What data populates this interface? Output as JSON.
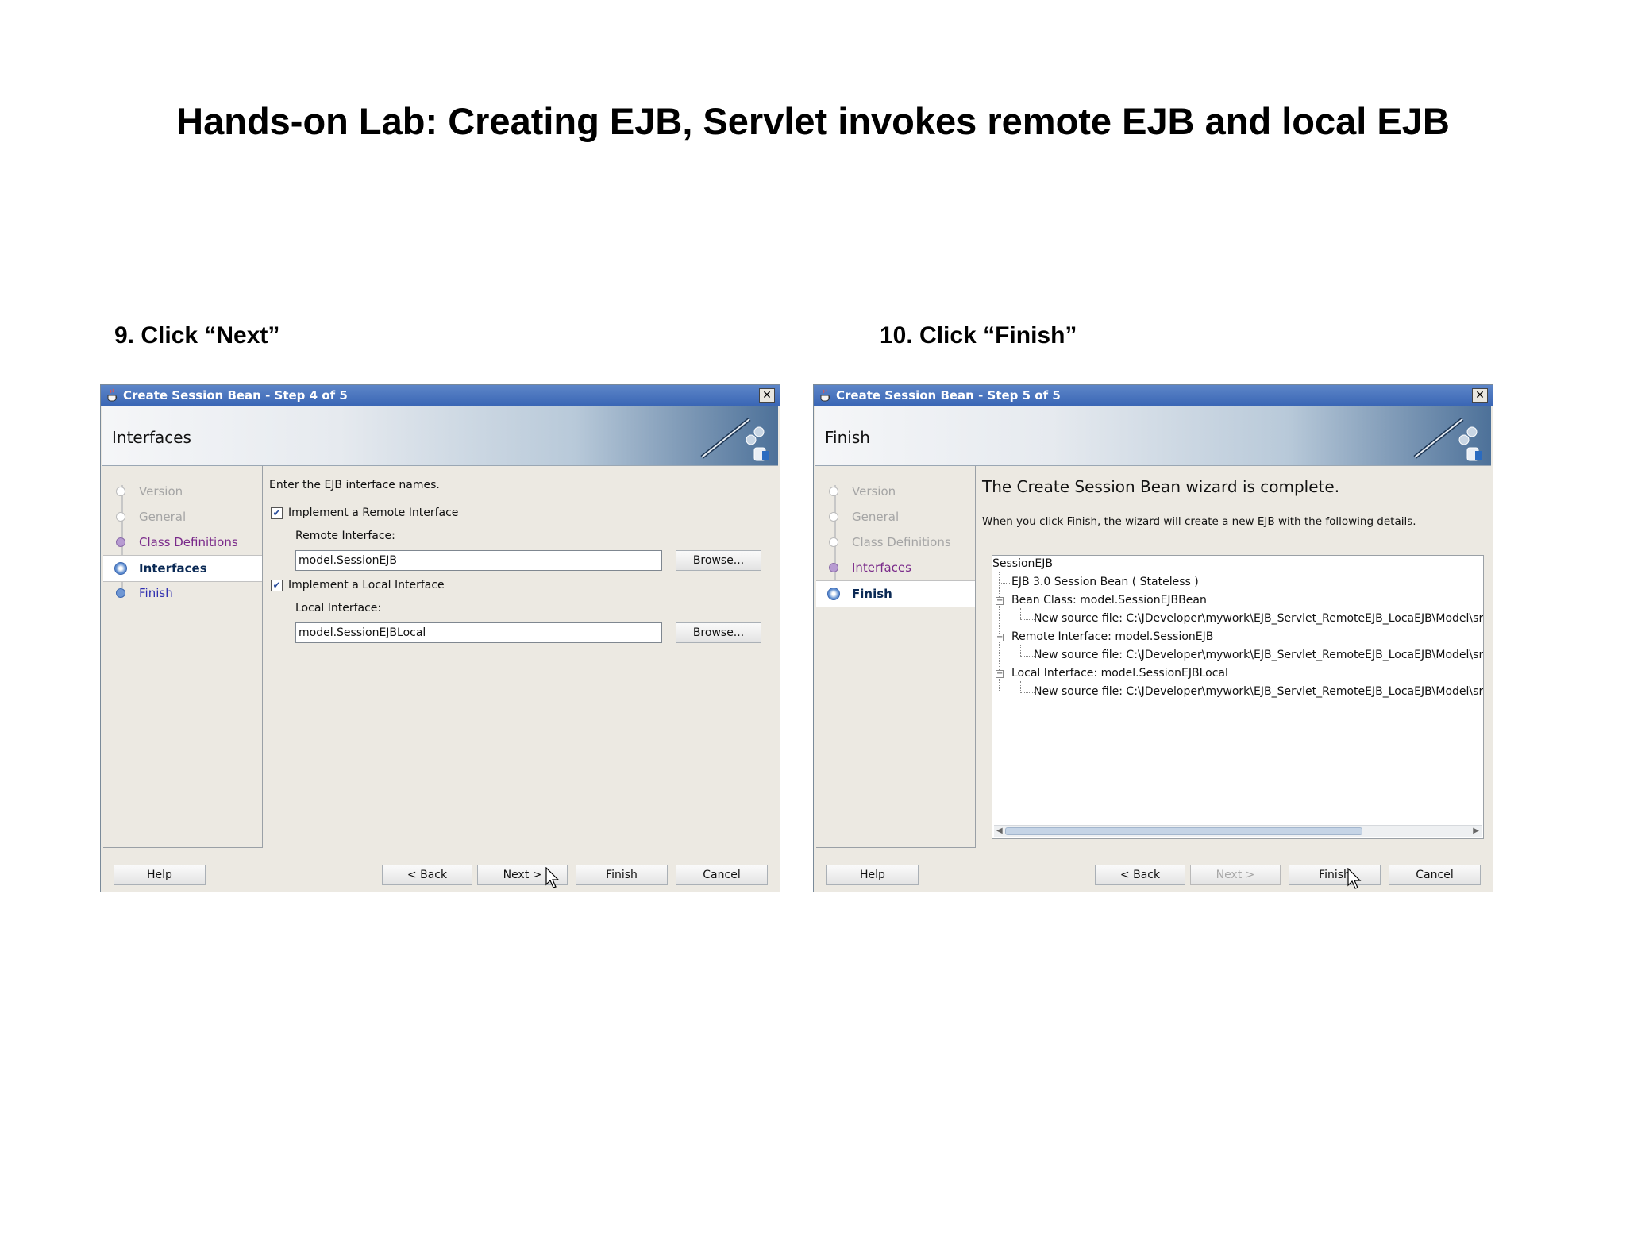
{
  "page_title": "Hands-on Lab: Creating EJB, Servlet invokes remote EJB and local EJB",
  "steps": [
    {
      "caption": "9. Click “Next”"
    },
    {
      "caption": "10. Click “Finish”"
    }
  ],
  "dialog1": {
    "window_title": "Create Session Bean - Step 4 of 5",
    "header": "Interfaces",
    "nav": [
      "Version",
      "General",
      "Class Definitions",
      "Interfaces",
      "Finish"
    ],
    "intro": "Enter the EJB interface names.",
    "remote_check_label": "Implement a Remote Interface",
    "remote_label": "Remote Interface:",
    "remote_value": "model.SessionEJB",
    "local_check_label": "Implement a Local Interface",
    "local_label": "Local Interface:",
    "local_value": "model.SessionEJBLocal",
    "browse": "Browse...",
    "buttons": {
      "help": "Help",
      "back": "< Back",
      "next": "Next >",
      "finish": "Finish",
      "cancel": "Cancel"
    }
  },
  "dialog2": {
    "window_title": "Create Session Bean - Step 5 of 5",
    "header": "Finish",
    "nav": [
      "Version",
      "General",
      "Class Definitions",
      "Interfaces",
      "Finish"
    ],
    "complete_msg": "The Create Session Bean wizard is complete.",
    "detail_msg": "When you click Finish, the wizard will create a new EJB with the following details.",
    "tree": {
      "root": "SessionEJB",
      "session": "EJB 3.0 Session Bean ( Stateless )",
      "bean_class": "Bean Class:  model.SessionEJBBean",
      "bean_src": "New source file:  C:\\JDeveloper\\mywork\\EJB_Servlet_RemoteEJB_LocaEJB\\Model\\src\\m",
      "remote": "Remote Interface:  model.SessionEJB",
      "remote_src": "New source file:  C:\\JDeveloper\\mywork\\EJB_Servlet_RemoteEJB_LocaEJB\\Model\\src\\m",
      "local": "Local Interface:  model.SessionEJBLocal",
      "local_src": "New source file:  C:\\JDeveloper\\mywork\\EJB_Servlet_RemoteEJB_LocaEJB\\Model\\src\\m"
    },
    "buttons": {
      "help": "Help",
      "back": "< Back",
      "next": "Next >",
      "finish": "Finish",
      "cancel": "Cancel"
    }
  }
}
